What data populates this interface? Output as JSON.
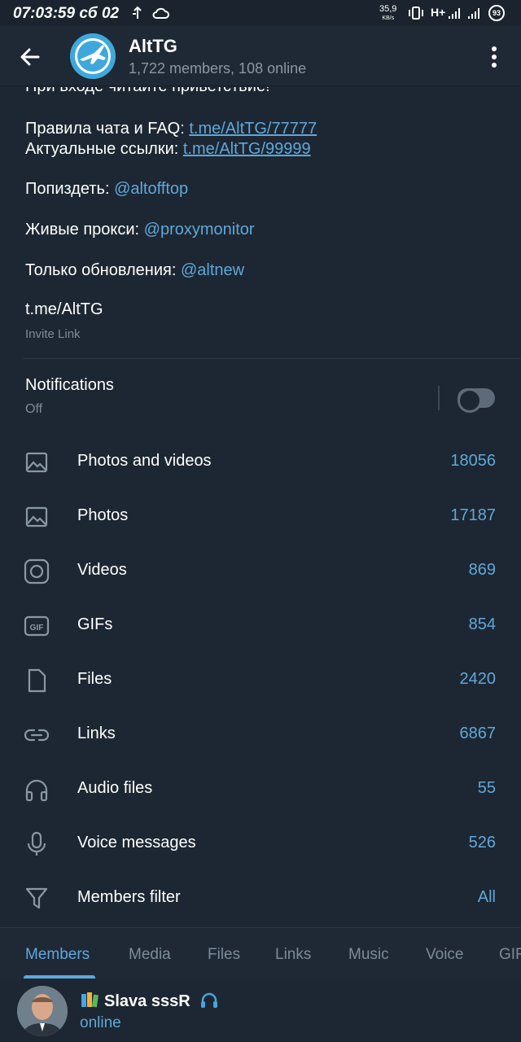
{
  "status_bar": {
    "time": "07:03:59 сб 02",
    "speed_value": "35,9",
    "speed_unit": "KB/s",
    "network": "H+",
    "battery": "93"
  },
  "header": {
    "title": "AltTG",
    "subtitle": "1,722 members, 108 online"
  },
  "description": {
    "partial_line": "При входе читайте приветствие!",
    "rules_label": "Правила чата и FAQ: ",
    "rules_link": "t.me/AltTG/77777",
    "links_label": "Актуальные ссылки: ",
    "links_link": "t.me/AltTG/99999",
    "offtop_label": "Попиздеть: ",
    "offtop_link": "@altofftop",
    "proxy_label": "Живые прокси: ",
    "proxy_link": "@proxymonitor",
    "updates_label": "Только обновления: ",
    "updates_link": "@altnew"
  },
  "invite": {
    "link": "t.me/AltTG",
    "label": "Invite Link"
  },
  "notifications": {
    "label": "Notifications",
    "value": "Off",
    "enabled": false
  },
  "media": [
    {
      "label": "Photos and videos",
      "count": "18056",
      "icon": "photo-video-icon"
    },
    {
      "label": "Photos",
      "count": "17187",
      "icon": "photo-icon"
    },
    {
      "label": "Videos",
      "count": "869",
      "icon": "video-icon"
    },
    {
      "label": "GIFs",
      "count": "854",
      "icon": "gif-icon"
    },
    {
      "label": "Files",
      "count": "2420",
      "icon": "file-icon"
    },
    {
      "label": "Links",
      "count": "6867",
      "icon": "link-icon"
    },
    {
      "label": "Audio files",
      "count": "55",
      "icon": "headphones-icon"
    },
    {
      "label": "Voice messages",
      "count": "526",
      "icon": "microphone-icon"
    },
    {
      "label": "Members filter",
      "count": "All",
      "icon": "filter-icon"
    }
  ],
  "tabs": [
    "Members",
    "Media",
    "Files",
    "Links",
    "Music",
    "Voice",
    "GIF"
  ],
  "active_tab": "Members",
  "member": {
    "name": "Slava sssR",
    "status": "online"
  },
  "colors": {
    "background": "#1d2733",
    "header": "#1f2936",
    "accent": "#5fa8d9",
    "secondary_text": "#7d8b98"
  }
}
